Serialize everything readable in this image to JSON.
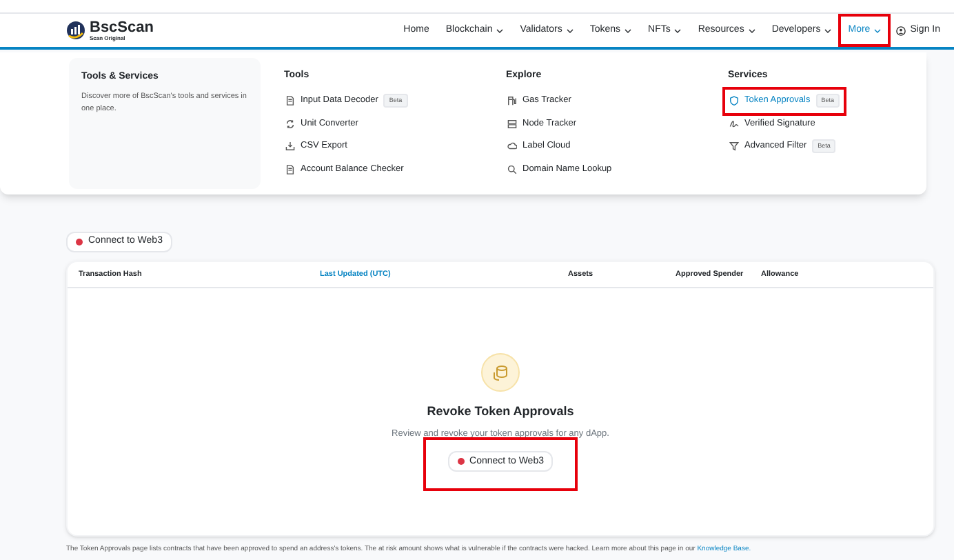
{
  "logo": {
    "name": "BscScan",
    "tagline": "Scan Original"
  },
  "nav": [
    {
      "label": "Home",
      "dropdown": false,
      "selected": false,
      "highlighted": false
    },
    {
      "label": "Blockchain",
      "dropdown": true,
      "selected": false,
      "highlighted": false
    },
    {
      "label": "Validators",
      "dropdown": true,
      "selected": false,
      "highlighted": false
    },
    {
      "label": "Tokens",
      "dropdown": true,
      "selected": false,
      "highlighted": false
    },
    {
      "label": "NFTs",
      "dropdown": true,
      "selected": false,
      "highlighted": false
    },
    {
      "label": "Resources",
      "dropdown": true,
      "selected": false,
      "highlighted": false
    },
    {
      "label": "Developers",
      "dropdown": true,
      "selected": false,
      "highlighted": false
    },
    {
      "label": "More",
      "dropdown": true,
      "selected": true,
      "highlighted": true
    }
  ],
  "sign_in": "Sign In",
  "menu": {
    "intro": {
      "title": "Tools & Services",
      "text": "Discover more of BscScan's tools and services in one place."
    },
    "columns": [
      {
        "title": "Tools",
        "items": [
          {
            "label": "Input Data Decoder",
            "badge": "Beta",
            "kind": "doc",
            "selected": false,
            "highlighted": false
          },
          {
            "label": "Unit Converter",
            "kind": "refresh",
            "selected": false,
            "highlighted": false
          },
          {
            "label": "CSV Export",
            "kind": "download",
            "selected": false,
            "highlighted": false
          },
          {
            "label": "Account Balance Checker",
            "kind": "doc",
            "selected": false,
            "highlighted": false
          }
        ]
      },
      {
        "title": "Explore",
        "items": [
          {
            "label": "Gas Tracker",
            "kind": "pump",
            "selected": false,
            "highlighted": false
          },
          {
            "label": "Node Tracker",
            "kind": "server",
            "selected": false,
            "highlighted": false
          },
          {
            "label": "Label Cloud",
            "kind": "cloud",
            "selected": false,
            "highlighted": false
          },
          {
            "label": "Domain Name Lookup",
            "kind": "search",
            "selected": false,
            "highlighted": false
          }
        ]
      },
      {
        "title": "Services",
        "items": [
          {
            "label": "Token Approvals",
            "badge": "Beta",
            "kind": "shield",
            "selected": true,
            "highlighted": true
          },
          {
            "label": "Verified Signature",
            "kind": "signature",
            "selected": false,
            "highlighted": false
          },
          {
            "label": "Advanced Filter",
            "badge": "Beta",
            "kind": "filter",
            "selected": false,
            "highlighted": false
          }
        ]
      }
    ]
  },
  "connect_button": {
    "label": "Connect to Web3",
    "connected": false
  },
  "table": {
    "columns": [
      {
        "label": "Transaction Hash",
        "link": false
      },
      {
        "label": "Last Updated (UTC)",
        "link": true
      },
      {
        "label": "Assets",
        "link": false
      },
      {
        "label": "Approved Spender",
        "link": false
      },
      {
        "label": "Allowance",
        "link": false
      }
    ]
  },
  "empty_state": {
    "title": "Revoke Token Approvals",
    "text": "Review and revoke your token approvals for any dApp.",
    "button": {
      "label": "Connect to Web3",
      "connected": false,
      "highlighted": true
    }
  },
  "footer_note": {
    "text": "The Token Approvals page lists contracts that have been approved to spend an address's tokens. The at risk amount shows what is vulnerable if the contracts were hacked. Learn more about this page in our",
    "link": "Knowledge Base."
  }
}
